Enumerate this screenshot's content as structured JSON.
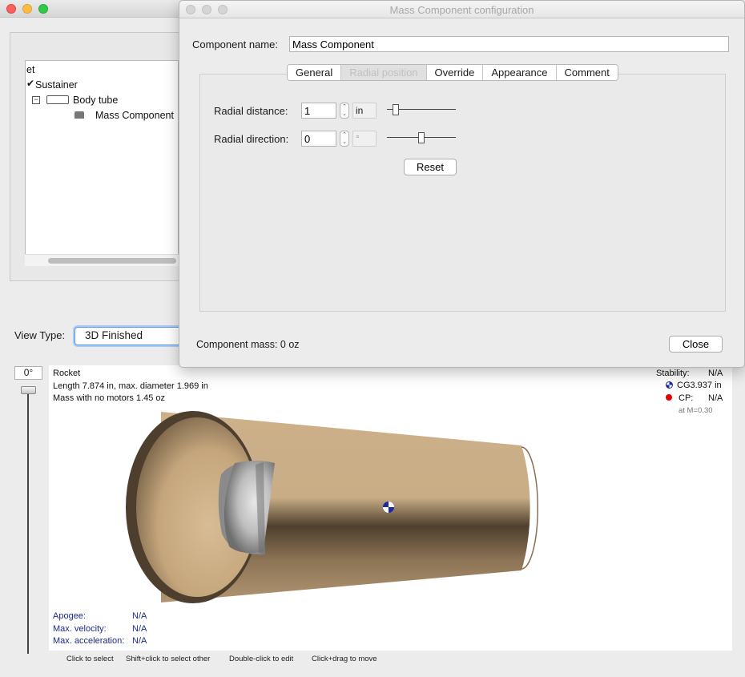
{
  "tree": {
    "root_partial": "et",
    "items": [
      "Sustainer",
      "Body tube",
      "Mass Component"
    ]
  },
  "view_type": {
    "label": "View Type:",
    "selected": "3D Finished"
  },
  "view3d": {
    "angle": "0°",
    "rocket_name": "Rocket",
    "length_line": "Length 7.874 in, max. diameter 1.969 in",
    "mass_line": "Mass with no motors 1.45 oz",
    "stability_label": "Stability:",
    "stability_value": "N/A",
    "cg_text": "CG3.937 in",
    "cp_label": "CP:",
    "cp_value": "N/A",
    "mach_note": "at M=0.30",
    "apogee_label": "Apogee:",
    "apogee_value": "N/A",
    "maxvel_label": "Max. velocity:",
    "maxvel_value": "N/A",
    "maxacc_label": "Max. acceleration:",
    "maxacc_value": "N/A",
    "hints": [
      "Click to select",
      "Shift+click to select other",
      "Double-click to edit",
      "Click+drag to move"
    ]
  },
  "dialog": {
    "title": "Mass Component configuration",
    "name_label": "Component name:",
    "name_value": "Mass Component",
    "tabs": [
      "General",
      "Radial position",
      "Override",
      "Appearance",
      "Comment"
    ],
    "selected_tab": "Radial position",
    "radial_distance_label": "Radial distance:",
    "radial_distance_value": "1",
    "radial_distance_unit": "in",
    "radial_direction_label": "Radial direction:",
    "radial_direction_value": "0",
    "radial_direction_unit": "°",
    "reset_label": "Reset",
    "mass_label": "Component mass: 0 oz",
    "close_label": "Close"
  },
  "colors": {
    "tube_outer": "#b89f7b",
    "tube_inner": "#4a3b2a",
    "tube_light": "#d9bf9a",
    "accent_blue": "#1a2a8c",
    "cp_red": "#e00000"
  }
}
